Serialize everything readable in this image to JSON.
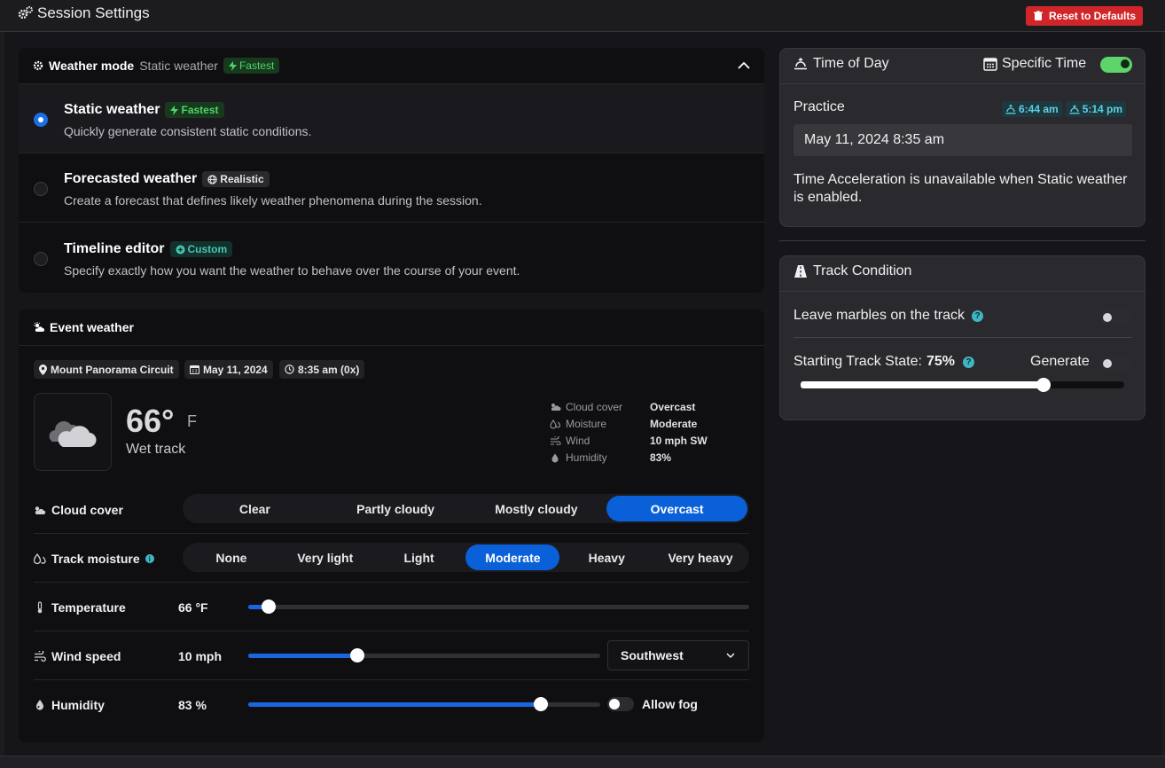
{
  "app": {
    "title": "Session Settings",
    "reset_label": "Reset to Defaults"
  },
  "weather_mode": {
    "label": "Weather mode",
    "current": "Static weather",
    "current_badge": "Fastest",
    "options": [
      {
        "title": "Static weather",
        "badge": "Fastest",
        "desc": "Quickly generate consistent static conditions.",
        "selected": true
      },
      {
        "title": "Forecasted weather",
        "badge": "Realistic",
        "desc": "Create a forecast that defines likely weather phenomena during the session.",
        "selected": false
      },
      {
        "title": "Timeline editor",
        "badge": "Custom",
        "desc": "Specify exactly how you want the weather to behave over the course of your event.",
        "selected": false
      }
    ]
  },
  "event_weather": {
    "label": "Event weather",
    "track": "Mount Panorama Circuit",
    "date": "May 11, 2024",
    "time": "8:35 am (0x)",
    "temp": "66°",
    "temp_unit": "F",
    "surface": "Wet track",
    "stats": [
      {
        "label": "Cloud cover",
        "value": "Overcast"
      },
      {
        "label": "Moisture",
        "value": "Moderate"
      },
      {
        "label": "Wind",
        "value": "10 mph SW"
      },
      {
        "label": "Humidity",
        "value": "83%"
      }
    ],
    "cloud_cover": {
      "label": "Cloud cover",
      "options": [
        "Clear",
        "Partly cloudy",
        "Mostly cloudy",
        "Overcast"
      ],
      "selected": "Overcast"
    },
    "track_moisture": {
      "label": "Track moisture",
      "options": [
        "None",
        "Very light",
        "Light",
        "Moderate",
        "Heavy",
        "Very heavy"
      ],
      "selected": "Moderate"
    },
    "temperature": {
      "label": "Temperature",
      "value": "66 °F",
      "fraction": 0.04
    },
    "wind": {
      "label": "Wind speed",
      "value": "10 mph",
      "fraction": 0.31,
      "direction": "Southwest"
    },
    "humidity": {
      "label": "Humidity",
      "value": "83 %",
      "fraction": 0.83,
      "fog_label": "Allow fog",
      "fog": false
    }
  },
  "time_of_day": {
    "title": "Time of Day",
    "specific_label": "Specific Time",
    "specific_on": true,
    "session": "Practice",
    "sunrise": "6:44 am",
    "sunset": "5:14 pm",
    "datetime": "May 11, 2024 8:35 am",
    "note": "Time Acceleration is unavailable when Static weather is enabled."
  },
  "track_condition": {
    "title": "Track Condition",
    "marbles_label": "Leave marbles on the track",
    "marbles_on": false,
    "start_state_label": "Starting Track State:",
    "start_state_value": "75%",
    "start_state_fraction": 0.75,
    "generate_label": "Generate",
    "generate_on": false
  }
}
